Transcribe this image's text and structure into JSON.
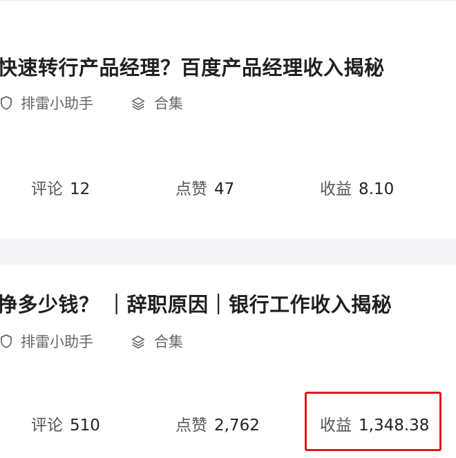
{
  "posts": [
    {
      "title": "快速转行产品经理？百度产品经理收入揭秘",
      "author": "排雷小助手",
      "collection": "合集",
      "stats": {
        "comments_label": "评论",
        "comments": "12",
        "likes_label": "点赞",
        "likes": "47",
        "earnings_label": "收益",
        "earnings": "8.10"
      }
    },
    {
      "title": "挣多少钱？ ｜辞职原因｜银行工作收入揭秘",
      "author": "排雷小助手",
      "collection": "合集",
      "stats": {
        "comments_label": "评论",
        "comments": "510",
        "likes_label": "点赞",
        "likes": "2,762",
        "earnings_label": "收益",
        "earnings": "1,348.38"
      }
    }
  ],
  "icons": {
    "author": "shield-icon",
    "collection": "layers-icon"
  },
  "colors": {
    "highlight": "#e0161b",
    "divider": "#f5f5f7"
  }
}
